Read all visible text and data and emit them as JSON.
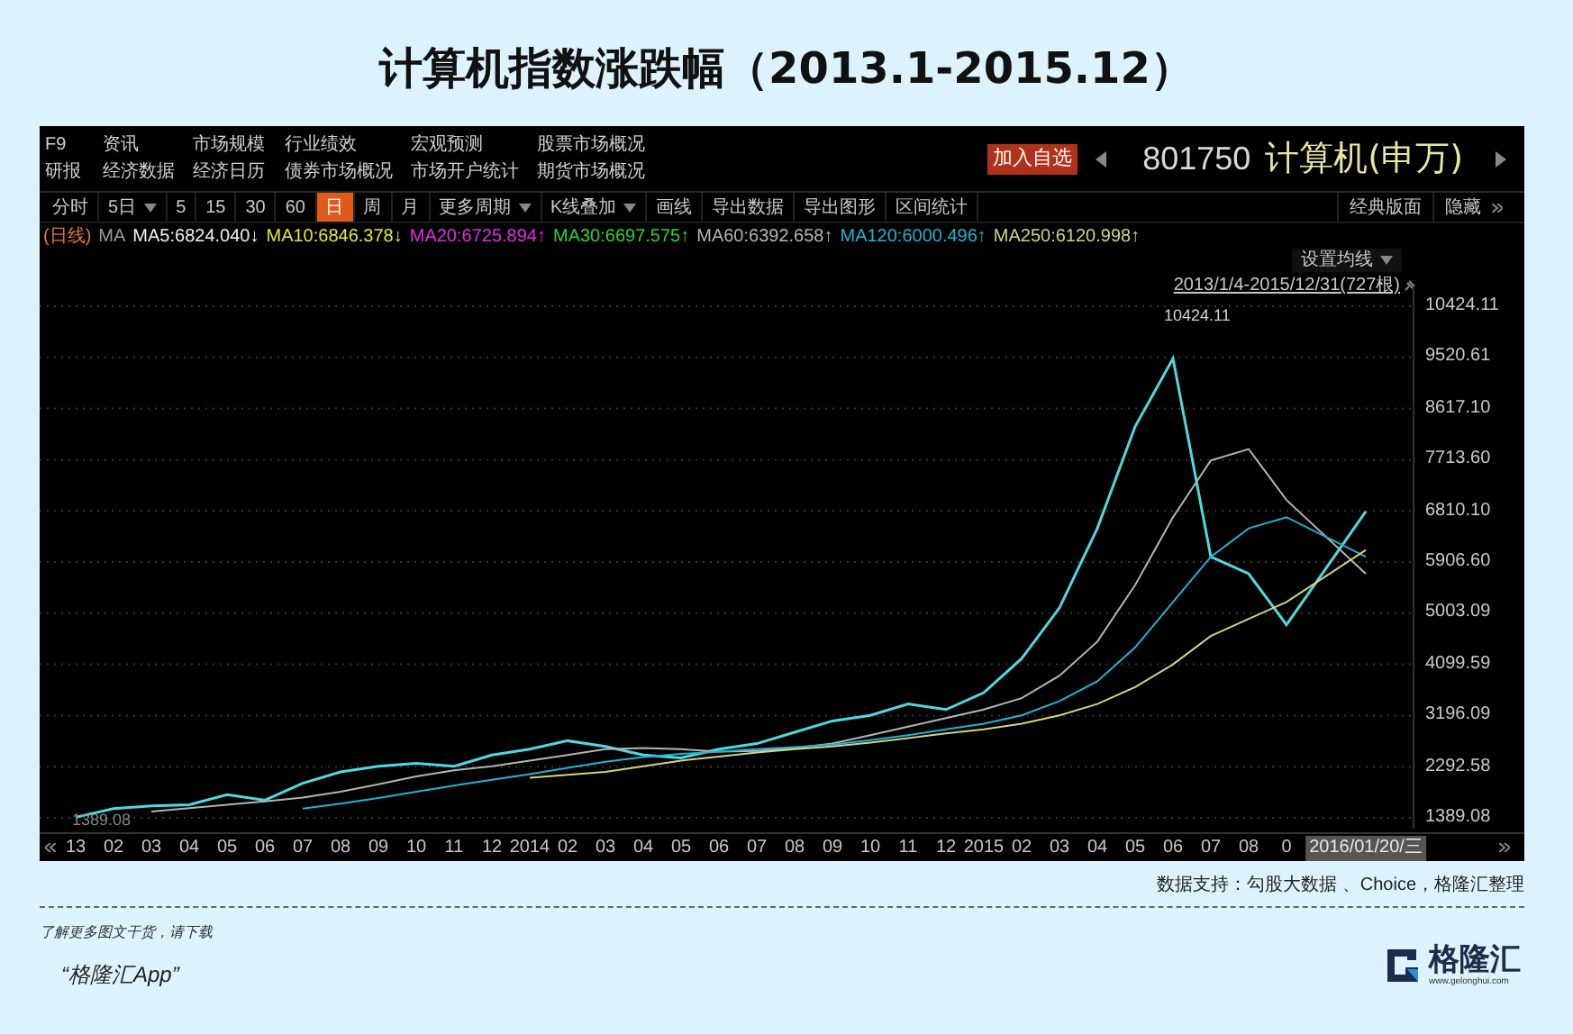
{
  "title": "计算机指数涨跌幅（2013.1-2015.12）",
  "menu": [
    [
      "F9",
      "资讯",
      "市场规模",
      "行业绩效",
      "宏观预测",
      "股票市场概况"
    ],
    [
      "研报",
      "经济数据",
      "经济日历",
      "债券市场概况",
      "市场开户统计",
      "期货市场概况"
    ]
  ],
  "add_watchlist": "加入自选",
  "code": "801750",
  "name": "计算机(申万)",
  "tabs": [
    {
      "label": "分时",
      "selected": false,
      "dropdown": false
    },
    {
      "label": "5日",
      "selected": false,
      "dropdown": true
    },
    {
      "label": "5",
      "selected": false,
      "dropdown": false
    },
    {
      "label": "15",
      "selected": false,
      "dropdown": false
    },
    {
      "label": "30",
      "selected": false,
      "dropdown": false
    },
    {
      "label": "60",
      "selected": false,
      "dropdown": false
    },
    {
      "label": "日",
      "selected": true,
      "dropdown": false
    },
    {
      "label": "周",
      "selected": false,
      "dropdown": false
    },
    {
      "label": "月",
      "selected": false,
      "dropdown": false
    },
    {
      "label": "更多周期",
      "selected": false,
      "dropdown": true
    },
    {
      "label": "K线叠加",
      "selected": false,
      "dropdown": true
    },
    {
      "label": "画线",
      "selected": false,
      "dropdown": false
    },
    {
      "label": "导出数据",
      "selected": false,
      "dropdown": false
    },
    {
      "label": "导出图形",
      "selected": false,
      "dropdown": false
    },
    {
      "label": "区间统计",
      "selected": false,
      "dropdown": false
    }
  ],
  "layout_buttons": [
    "经典版面",
    "隐藏"
  ],
  "ma_legend": [
    {
      "text": "(日线)",
      "color": "#e0782c"
    },
    {
      "text": "MA",
      "color": "#9a9a9a"
    },
    {
      "text": "MA5:6824.040↓",
      "color": "#f0f0f0"
    },
    {
      "text": "MA10:6846.378↓",
      "color": "#e6e62e"
    },
    {
      "text": "MA20:6725.894↑",
      "color": "#e02ee0"
    },
    {
      "text": "MA30:6697.575↑",
      "color": "#2ed22e"
    },
    {
      "text": "MA60:6392.658↑",
      "color": "#b4b4b4"
    },
    {
      "text": "MA120:6000.496↑",
      "color": "#1eb4d2"
    },
    {
      "text": "MA250:6120.998↑",
      "color": "#d2d282"
    }
  ],
  "ma_settings": "设置均线",
  "date_range": "2013/1/4-2015/12/31(727根)",
  "chart": {
    "chart_data": {
      "type": "line",
      "categories": [
        "13",
        "02",
        "03",
        "04",
        "05",
        "06",
        "07",
        "08",
        "09",
        "10",
        "11",
        "12",
        "2014",
        "02",
        "03",
        "04",
        "05",
        "06",
        "07",
        "08",
        "09",
        "10",
        "11",
        "12",
        "2015",
        "02",
        "03",
        "04",
        "05",
        "06",
        "07",
        "08",
        "0",
        "2016/01/20/三"
      ],
      "series": [
        {
          "color": "#4fd8e0",
          "values": [
            1400,
            1550,
            1600,
            1620,
            1800,
            1700,
            2000,
            2200,
            2300,
            2350,
            2300,
            2500,
            2600,
            2750,
            2650,
            2500,
            2450,
            2600,
            2700,
            2900,
            3100,
            3200,
            3400,
            3300,
            3600,
            4200,
            5100,
            6500,
            8300,
            9500,
            6000,
            5700,
            4800,
            6800
          ]
        },
        {
          "color": "#b4b4b4",
          "values": [
            null,
            null,
            1500,
            1560,
            1620,
            1680,
            1750,
            1850,
            1980,
            2120,
            2230,
            2300,
            2400,
            2500,
            2600,
            2620,
            2600,
            2560,
            2570,
            2620,
            2700,
            2850,
            3000,
            3150,
            3300,
            3500,
            3900,
            4500,
            5500,
            6700,
            7700,
            7900,
            7000,
            5700
          ]
        },
        {
          "color": "#1eb4d2",
          "values": [
            null,
            null,
            null,
            null,
            null,
            null,
            1550,
            1640,
            1740,
            1850,
            1960,
            2060,
            2160,
            2270,
            2380,
            2460,
            2520,
            2560,
            2600,
            2640,
            2680,
            2760,
            2850,
            2950,
            3050,
            3200,
            3450,
            3800,
            4400,
            5200,
            6000,
            6500,
            6700,
            6000
          ]
        },
        {
          "color": "#d2d282",
          "values": [
            null,
            null,
            null,
            null,
            null,
            null,
            null,
            null,
            null,
            null,
            null,
            null,
            2100,
            2150,
            2200,
            2300,
            2400,
            2470,
            2540,
            2600,
            2650,
            2720,
            2800,
            2880,
            2950,
            3050,
            3200,
            3400,
            3700,
            4100,
            4600,
            4900,
            5200,
            6120
          ]
        }
      ],
      "ylim": [
        1389.08,
        10424.11
      ],
      "grid": true,
      "yticks": [
        {
          "value": 10424.11,
          "label": "10424.11"
        },
        {
          "value": 9520.61,
          "label": "9520.61"
        },
        {
          "value": 8617.1,
          "label": "8617.10"
        },
        {
          "value": 7713.6,
          "label": "7713.60"
        },
        {
          "value": 6810.1,
          "label": "6810.10"
        },
        {
          "value": 5906.6,
          "label": "5906.60"
        },
        {
          "value": 5003.09,
          "label": "5003.09"
        },
        {
          "value": 4099.59,
          "label": "4099.59"
        },
        {
          "value": 3196.09,
          "label": "3196.09"
        },
        {
          "value": 2292.58,
          "label": "2292.58"
        },
        {
          "value": 1389.08,
          "label": "1389.08"
        }
      ]
    },
    "peak_label": "10424.11",
    "low_label": "1389.08"
  },
  "source": "数据支持：勾股大数据 、Choice，格隆汇整理",
  "footer": {
    "note": "了解更多图文干货，请下载",
    "app": "“格隆汇App”",
    "logo_name": "格隆汇",
    "logo_url": "www.gelonghui.com"
  }
}
